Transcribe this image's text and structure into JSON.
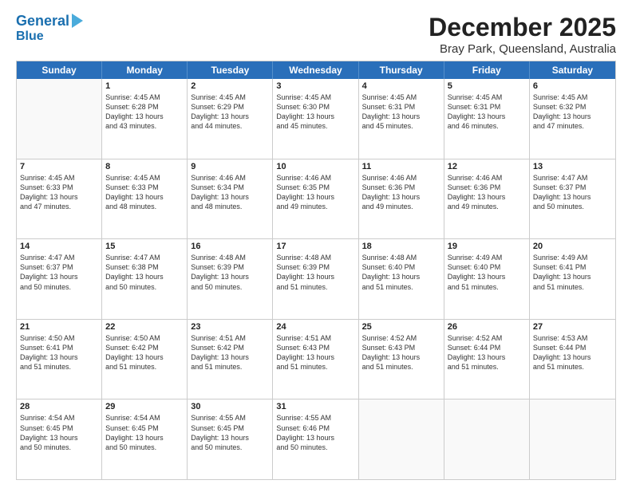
{
  "header": {
    "logo_line1": "General",
    "logo_line2": "Blue",
    "month": "December 2025",
    "location": "Bray Park, Queensland, Australia"
  },
  "weekdays": [
    "Sunday",
    "Monday",
    "Tuesday",
    "Wednesday",
    "Thursday",
    "Friday",
    "Saturday"
  ],
  "rows": [
    [
      {
        "day": "",
        "info": ""
      },
      {
        "day": "1",
        "info": "Sunrise: 4:45 AM\nSunset: 6:28 PM\nDaylight: 13 hours\nand 43 minutes."
      },
      {
        "day": "2",
        "info": "Sunrise: 4:45 AM\nSunset: 6:29 PM\nDaylight: 13 hours\nand 44 minutes."
      },
      {
        "day": "3",
        "info": "Sunrise: 4:45 AM\nSunset: 6:30 PM\nDaylight: 13 hours\nand 45 minutes."
      },
      {
        "day": "4",
        "info": "Sunrise: 4:45 AM\nSunset: 6:31 PM\nDaylight: 13 hours\nand 45 minutes."
      },
      {
        "day": "5",
        "info": "Sunrise: 4:45 AM\nSunset: 6:31 PM\nDaylight: 13 hours\nand 46 minutes."
      },
      {
        "day": "6",
        "info": "Sunrise: 4:45 AM\nSunset: 6:32 PM\nDaylight: 13 hours\nand 47 minutes."
      }
    ],
    [
      {
        "day": "7",
        "info": "Sunrise: 4:45 AM\nSunset: 6:33 PM\nDaylight: 13 hours\nand 47 minutes."
      },
      {
        "day": "8",
        "info": "Sunrise: 4:45 AM\nSunset: 6:33 PM\nDaylight: 13 hours\nand 48 minutes."
      },
      {
        "day": "9",
        "info": "Sunrise: 4:46 AM\nSunset: 6:34 PM\nDaylight: 13 hours\nand 48 minutes."
      },
      {
        "day": "10",
        "info": "Sunrise: 4:46 AM\nSunset: 6:35 PM\nDaylight: 13 hours\nand 49 minutes."
      },
      {
        "day": "11",
        "info": "Sunrise: 4:46 AM\nSunset: 6:36 PM\nDaylight: 13 hours\nand 49 minutes."
      },
      {
        "day": "12",
        "info": "Sunrise: 4:46 AM\nSunset: 6:36 PM\nDaylight: 13 hours\nand 49 minutes."
      },
      {
        "day": "13",
        "info": "Sunrise: 4:47 AM\nSunset: 6:37 PM\nDaylight: 13 hours\nand 50 minutes."
      }
    ],
    [
      {
        "day": "14",
        "info": "Sunrise: 4:47 AM\nSunset: 6:37 PM\nDaylight: 13 hours\nand 50 minutes."
      },
      {
        "day": "15",
        "info": "Sunrise: 4:47 AM\nSunset: 6:38 PM\nDaylight: 13 hours\nand 50 minutes."
      },
      {
        "day": "16",
        "info": "Sunrise: 4:48 AM\nSunset: 6:39 PM\nDaylight: 13 hours\nand 50 minutes."
      },
      {
        "day": "17",
        "info": "Sunrise: 4:48 AM\nSunset: 6:39 PM\nDaylight: 13 hours\nand 51 minutes."
      },
      {
        "day": "18",
        "info": "Sunrise: 4:48 AM\nSunset: 6:40 PM\nDaylight: 13 hours\nand 51 minutes."
      },
      {
        "day": "19",
        "info": "Sunrise: 4:49 AM\nSunset: 6:40 PM\nDaylight: 13 hours\nand 51 minutes."
      },
      {
        "day": "20",
        "info": "Sunrise: 4:49 AM\nSunset: 6:41 PM\nDaylight: 13 hours\nand 51 minutes."
      }
    ],
    [
      {
        "day": "21",
        "info": "Sunrise: 4:50 AM\nSunset: 6:41 PM\nDaylight: 13 hours\nand 51 minutes."
      },
      {
        "day": "22",
        "info": "Sunrise: 4:50 AM\nSunset: 6:42 PM\nDaylight: 13 hours\nand 51 minutes."
      },
      {
        "day": "23",
        "info": "Sunrise: 4:51 AM\nSunset: 6:42 PM\nDaylight: 13 hours\nand 51 minutes."
      },
      {
        "day": "24",
        "info": "Sunrise: 4:51 AM\nSunset: 6:43 PM\nDaylight: 13 hours\nand 51 minutes."
      },
      {
        "day": "25",
        "info": "Sunrise: 4:52 AM\nSunset: 6:43 PM\nDaylight: 13 hours\nand 51 minutes."
      },
      {
        "day": "26",
        "info": "Sunrise: 4:52 AM\nSunset: 6:44 PM\nDaylight: 13 hours\nand 51 minutes."
      },
      {
        "day": "27",
        "info": "Sunrise: 4:53 AM\nSunset: 6:44 PM\nDaylight: 13 hours\nand 51 minutes."
      }
    ],
    [
      {
        "day": "28",
        "info": "Sunrise: 4:54 AM\nSunset: 6:45 PM\nDaylight: 13 hours\nand 50 minutes."
      },
      {
        "day": "29",
        "info": "Sunrise: 4:54 AM\nSunset: 6:45 PM\nDaylight: 13 hours\nand 50 minutes."
      },
      {
        "day": "30",
        "info": "Sunrise: 4:55 AM\nSunset: 6:45 PM\nDaylight: 13 hours\nand 50 minutes."
      },
      {
        "day": "31",
        "info": "Sunrise: 4:55 AM\nSunset: 6:46 PM\nDaylight: 13 hours\nand 50 minutes."
      },
      {
        "day": "",
        "info": ""
      },
      {
        "day": "",
        "info": ""
      },
      {
        "day": "",
        "info": ""
      }
    ]
  ]
}
